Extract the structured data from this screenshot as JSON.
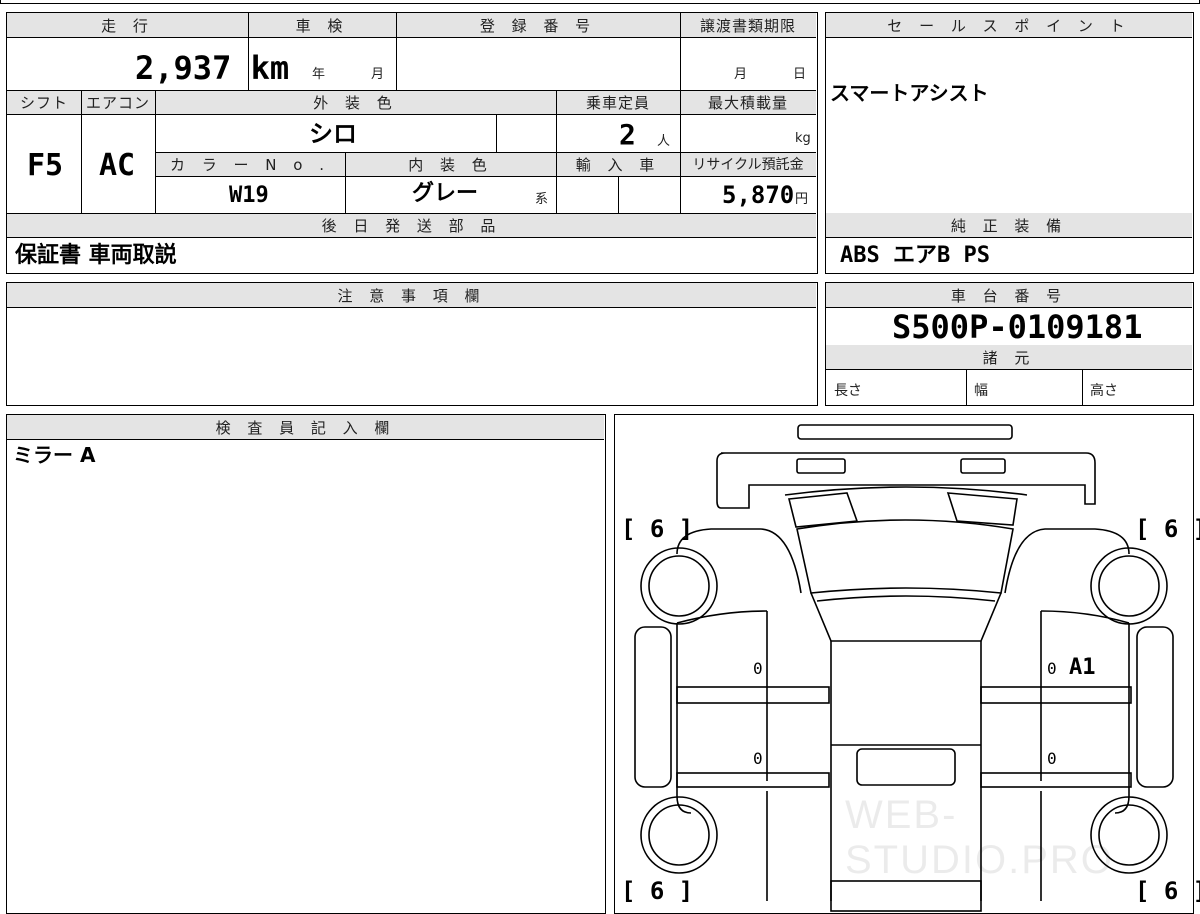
{
  "top": {
    "headers": {
      "mileage": "走 行",
      "shaken": "車 検",
      "registration": "登 録 番 号",
      "transfer_deadline": "譲渡書類期限",
      "sales_point": "セ ー ル ス ポ イ ン ト",
      "shift": "シフト",
      "aircon": "エアコン",
      "exterior_color": "外 装 色",
      "capacity": "乗車定員",
      "max_load": "最大積載量",
      "color_no": "カ ラ ー N o .",
      "interior_color": "内 装 色",
      "import": "輸 入 車",
      "recycle": "リサイクル預託金",
      "later_parts": "後 日 発 送 部 品",
      "genuine_equipment": "純 正 装 備",
      "notes": "注 意 事 項 欄",
      "chassis": "車 台 番 号",
      "specs": "諸 元",
      "inspector": "検 査 員 記 入 欄"
    },
    "mileage_value": "2,937 km",
    "shaken_year_unit": "年",
    "shaken_month_unit": "月",
    "transfer_month_unit": "月",
    "transfer_day_unit": "日",
    "sales_point_text": "スマートアシスト",
    "shift_value": "F5",
    "aircon_value": "AC",
    "exterior_color_value": "シロ",
    "capacity_value": "2",
    "capacity_unit": "人",
    "load_unit": "kg",
    "color_no_value": "W19",
    "interior_color_value": "グレー",
    "interior_suffix": "系",
    "recycle_value": "5,870",
    "recycle_unit": "円",
    "later_parts_value": "保証書 車両取説",
    "genuine_equipment_value": "ABS エアB PS",
    "chassis_value": "S500P-0109181",
    "spec_length": "長さ",
    "spec_width": "幅",
    "spec_height": "高さ",
    "inspector_text": "ミラー A"
  },
  "diagram": {
    "bracket_tl": "[ 6 ]",
    "bracket_tr": "[ 6 ]",
    "bracket_bl": "[ 6 ]",
    "bracket_br": "[ 6 ]",
    "mark_left_front": "0",
    "mark_right_front": "0",
    "mark_right_front_code": "A1",
    "mark_left_rear": "0",
    "mark_right_rear": "0",
    "watermark": "WEB-STUDIO.PRO"
  }
}
